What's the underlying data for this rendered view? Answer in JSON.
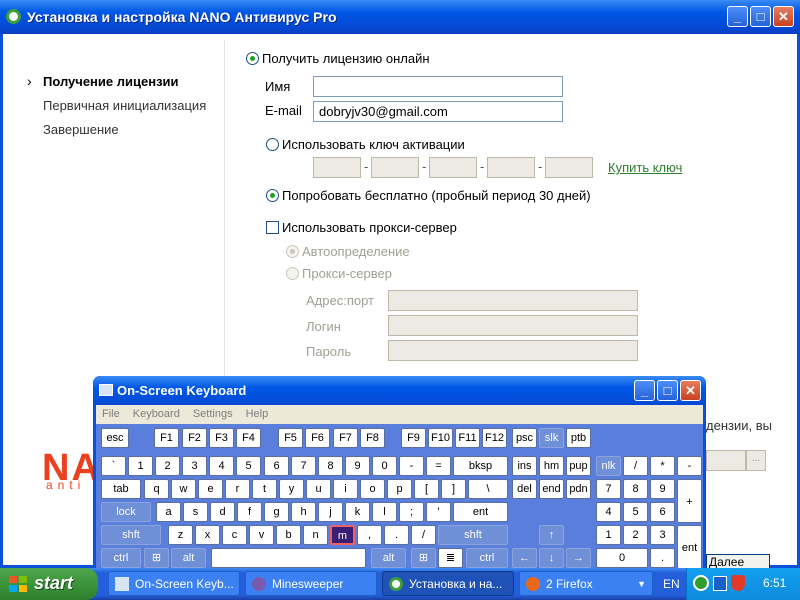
{
  "window": {
    "title": "Установка и настройка NANO Антивирус Pro"
  },
  "nav": {
    "items": [
      "Получение лицензии",
      "Первичная инициализация",
      "Завершение"
    ]
  },
  "form": {
    "online_label": "Получить лицензию онлайн",
    "name_label": "Имя",
    "name_value": "",
    "email_label": "E-mail",
    "email_value": "dobryjv30@gmail.com",
    "key_label": "Использовать ключ активации",
    "buy_key": "Купить ключ",
    "trial_label": "Попробовать бесплатно (пробный период 30 дней)",
    "proxy_label": "Использовать прокси-сервер",
    "auto_label": "Автоопределение",
    "proxy_server_label": "Прокси-сервер",
    "addr_label": "Адрес:порт",
    "login_label": "Логин",
    "pass_label": "Пароль",
    "hidden_text": "дензии, вы",
    "next_button": "Далее"
  },
  "logo": {
    "text": "NAN",
    "sub": "anti"
  },
  "osk": {
    "title": "On-Screen Keyboard",
    "menu": [
      "File",
      "Keyboard",
      "Settings",
      "Help"
    ],
    "selected_key": "m"
  },
  "taskbar": {
    "start": "start",
    "items": [
      "On-Screen Keyb...",
      "Minesweeper",
      "Установка и на...",
      "2 Firefox"
    ],
    "lang": "EN",
    "clock": "6:51"
  },
  "colors": {
    "xp_blue": "#0058e6",
    "accent_green": "#2c7e2c",
    "nano_red": "#ec3f1e"
  }
}
